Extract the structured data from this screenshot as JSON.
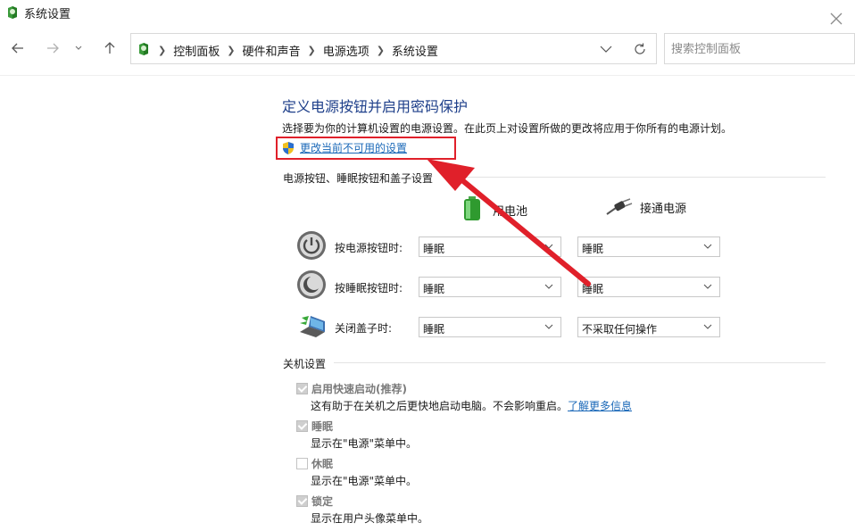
{
  "window": {
    "title": "系统设置"
  },
  "address": {
    "crumbs": [
      "控制面板",
      "硬件和声音",
      "电源选项",
      "系统设置"
    ],
    "search_placeholder": "搜索控制面板"
  },
  "main": {
    "title": "定义电源按钮并启用密码保护",
    "description": "选择要为你的计算机设置的电源设置。在此页上对设置所做的更改将应用于你所有的电源计划。",
    "change_link": "更改当前不可用的设置"
  },
  "power_section": {
    "title": "电源按钮、睡眠按钮和盖子设置",
    "battery_label": "用电池",
    "plugged_label": "接通电源",
    "rows": [
      {
        "label": "按电源按钮时:",
        "battery": "睡眠",
        "plugged": "睡眠",
        "icon": "power-icon"
      },
      {
        "label": "按睡眠按钮时:",
        "battery": "睡眠",
        "plugged": "睡眠",
        "icon": "sleep-icon"
      },
      {
        "label": "关闭盖子时:",
        "battery": "睡眠",
        "plugged": "不采取任何操作",
        "icon": "laptop-lid-icon"
      }
    ]
  },
  "shutdown_section": {
    "title": "关机设置",
    "options": [
      {
        "label": "启用快速启动(推荐)",
        "checked": true,
        "desc_text": "这有助于在关机之后更快地启动电脑。不会影响重启。",
        "desc_link": "了解更多信息"
      },
      {
        "label": "睡眠",
        "checked": true,
        "desc_text": "显示在\"电源\"菜单中。"
      },
      {
        "label": "休眠",
        "checked": false,
        "desc_text": "显示在\"电源\"菜单中。"
      },
      {
        "label": "锁定",
        "checked": true,
        "desc_text": "显示在用户头像菜单中。"
      }
    ]
  },
  "colors": {
    "title_blue": "#1e3f8a",
    "link_blue": "#1a68b8",
    "highlight_red": "#e0202a"
  }
}
